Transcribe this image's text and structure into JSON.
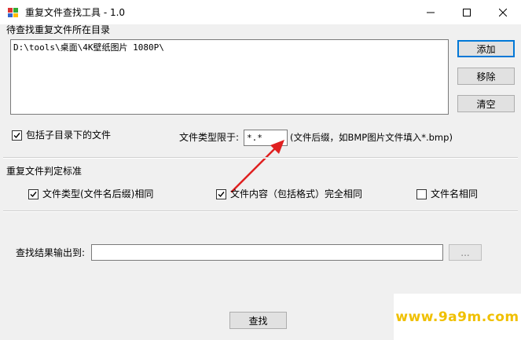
{
  "window": {
    "title": "重复文件查找工具 - 1.0",
    "controls": {
      "minimize": "minimize-icon",
      "maximize": "maximize-icon",
      "close": "close-icon"
    }
  },
  "directory_section": {
    "label": "待查找重复文件所在目录",
    "items": [
      "D:\\tools\\桌面\\4K壁纸图片 1080P\\"
    ],
    "buttons": {
      "add": "添加",
      "remove": "移除",
      "clear": "清空"
    }
  },
  "include_subdirs": {
    "label": "包括子目录下的文件",
    "checked": true
  },
  "file_type": {
    "label": "文件类型限于:",
    "value": "*.*",
    "hint": "(文件后缀，如BMP图片文件填入*.bmp)"
  },
  "criteria": {
    "label": "重复文件判定标准",
    "options": [
      {
        "label": "文件类型(文件名后缀)相同",
        "checked": true
      },
      {
        "label": "文件内容（包括格式）完全相同",
        "checked": true
      },
      {
        "label": "文件名相同",
        "checked": false
      }
    ]
  },
  "output": {
    "label": "查找结果输出到:",
    "value": "",
    "browse_label": "..."
  },
  "search_button": "查找",
  "watermark": "www.9a9m.com",
  "colors": {
    "arrow": "#e02020",
    "watermark": "#f0c000",
    "accent": "#0078d7"
  }
}
